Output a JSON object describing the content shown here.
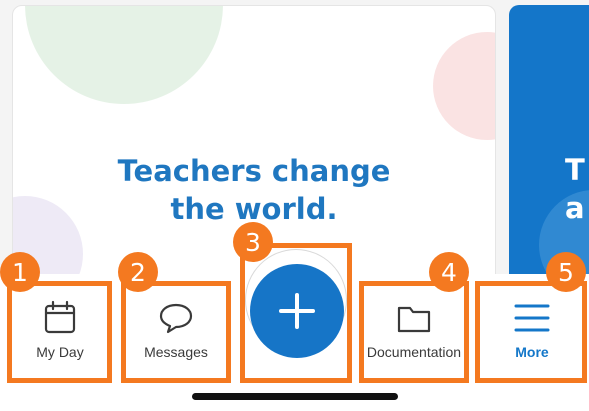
{
  "banner": {
    "line1": "Teachers change",
    "line2": "the world.",
    "next_card_partial_lines": [
      "T",
      "a"
    ]
  },
  "tabs": [
    {
      "id": "my-day",
      "label": "My Day",
      "icon": "calendar-icon",
      "active": false
    },
    {
      "id": "messages",
      "label": "Messages",
      "icon": "speech-bubble-icon",
      "active": false
    },
    {
      "id": "add",
      "label": "",
      "icon": "plus-icon",
      "active": false
    },
    {
      "id": "documentation",
      "label": "Documentation",
      "icon": "folder-icon",
      "active": false
    },
    {
      "id": "more",
      "label": "More",
      "icon": "hamburger-menu-icon",
      "active": true
    }
  ],
  "annotations": [
    "1",
    "2",
    "3",
    "4",
    "5"
  ],
  "colors": {
    "brand_blue": "#1675c7",
    "text_blue": "#1f77c0",
    "annotation_orange": "#f47920",
    "icon_dark": "#3a3a3a"
  }
}
